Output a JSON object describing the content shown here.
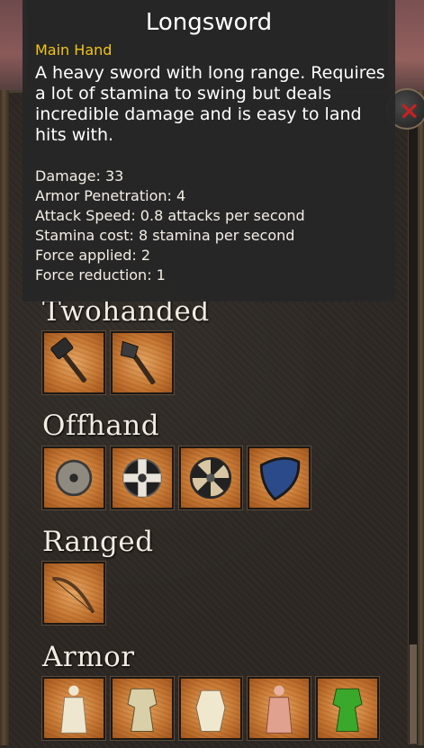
{
  "tooltip": {
    "title": "Longsword",
    "slot": "Main Hand",
    "description": "A heavy sword with long range. Requires a lot of stamina to swing but deals incredible damage and is easy to land hits with.",
    "stats": [
      "Damage: 33",
      "Armor Penetration: 4",
      "Attack Speed: 0.8 attacks per second",
      "Stamina cost: 8 stamina per second",
      "Force applied: 2",
      "Force reduction: 1"
    ]
  },
  "sections": {
    "twohanded": {
      "title": "Twohanded",
      "items": [
        "hammer-icon",
        "axe-icon"
      ]
    },
    "offhand": {
      "title": "Offhand",
      "items": [
        "round-wooden-shield-icon",
        "cross-shield-icon",
        "striped-shield-icon",
        "blue-heater-shield-icon"
      ]
    },
    "ranged": {
      "title": "Ranged",
      "items": [
        "bow-icon"
      ]
    },
    "armor": {
      "title": "Armor",
      "items": [
        "white-robe-armor-icon",
        "light-armor-icon",
        "plate-armor-icon",
        "red-robe-armor-icon",
        "green-armor-icon"
      ]
    }
  },
  "close_button": {
    "icon": "close-icon",
    "symbol": "×"
  },
  "colors": {
    "slot_background": "#c97b36",
    "tooltip_background": "#262626",
    "tooltip_slot_label": "#f0c419",
    "close_icon": "#c42222"
  }
}
